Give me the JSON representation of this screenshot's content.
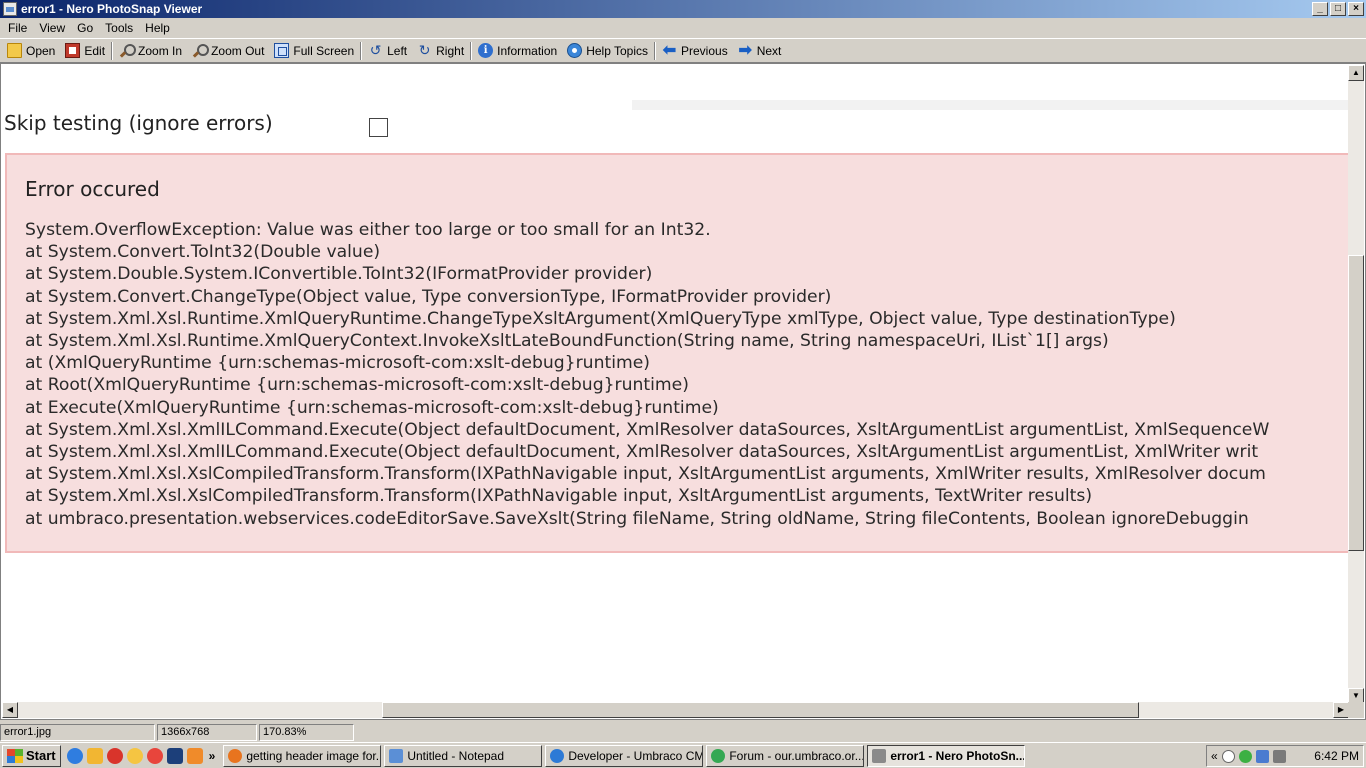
{
  "window": {
    "title": "error1 - Nero PhotoSnap Viewer",
    "buttons": {
      "minimize": "_",
      "maximize": "□",
      "close": "×"
    }
  },
  "menu": [
    "File",
    "View",
    "Go",
    "Tools",
    "Help"
  ],
  "toolbar": {
    "open": "Open",
    "edit": "Edit",
    "zoom_in": "Zoom In",
    "zoom_out": "Zoom Out",
    "full_screen": "Full Screen",
    "left": "Left",
    "right": "Right",
    "information": "Information",
    "help_topics": "Help Topics",
    "previous": "Previous",
    "next": "Next"
  },
  "image": {
    "skip_label": "Skip testing (ignore errors)",
    "error_title": "Error occured",
    "error_lines": [
      "System.OverflowException: Value was either too large or too small for an Int32.",
      "at System.Convert.ToInt32(Double value)",
      "at System.Double.System.IConvertible.ToInt32(IFormatProvider provider)",
      "at System.Convert.ChangeType(Object value, Type conversionType, IFormatProvider provider)",
      "at System.Xml.Xsl.Runtime.XmlQueryRuntime.ChangeTypeXsltArgument(XmlQueryType xmlType, Object value, Type destinationType)",
      "at System.Xml.Xsl.Runtime.XmlQueryContext.InvokeXsltLateBoundFunction(String name, String namespaceUri, IList`1[] args)",
      "at (XmlQueryRuntime {urn:schemas-microsoft-com:xslt-debug}runtime)",
      "at Root(XmlQueryRuntime {urn:schemas-microsoft-com:xslt-debug}runtime)",
      "at Execute(XmlQueryRuntime {urn:schemas-microsoft-com:xslt-debug}runtime)",
      "at System.Xml.Xsl.XmlILCommand.Execute(Object defaultDocument, XmlResolver dataSources, XsltArgumentList argumentList, XmlSequenceW",
      "at System.Xml.Xsl.XmlILCommand.Execute(Object defaultDocument, XmlResolver dataSources, XsltArgumentList argumentList, XmlWriter writ",
      "at System.Xml.Xsl.XslCompiledTransform.Transform(IXPathNavigable input, XsltArgumentList arguments, XmlWriter results, XmlResolver docum",
      "at System.Xml.Xsl.XslCompiledTransform.Transform(IXPathNavigable input, XsltArgumentList arguments, TextWriter results)",
      "at umbraco.presentation.webservices.codeEditorSave.SaveXslt(String fileName, String oldName, String fileContents, Boolean ignoreDebuggin"
    ]
  },
  "status": {
    "filename": "error1.jpg",
    "dimensions": "1366x768",
    "zoom": "170.83%"
  },
  "taskbar": {
    "start": "Start",
    "more": "»",
    "tasks": [
      {
        "label": "getting header image for...",
        "color": "#e8741e"
      },
      {
        "label": "Untitled - Notepad",
        "color": "#5b8fd6"
      },
      {
        "label": "Developer - Umbraco CM...",
        "color": "#2d7ad6"
      },
      {
        "label": "Forum - our.umbraco.or...",
        "color": "#34a853"
      },
      {
        "label": "error1 - Nero PhotoSn...",
        "color": "#8a8a8a",
        "active": true
      }
    ],
    "tray_expand": "«",
    "clock": "6:42 PM"
  },
  "colors": {
    "error_bg": "#f7dede",
    "error_border": "#f1b9b9",
    "titlebar": "#0a246a"
  }
}
